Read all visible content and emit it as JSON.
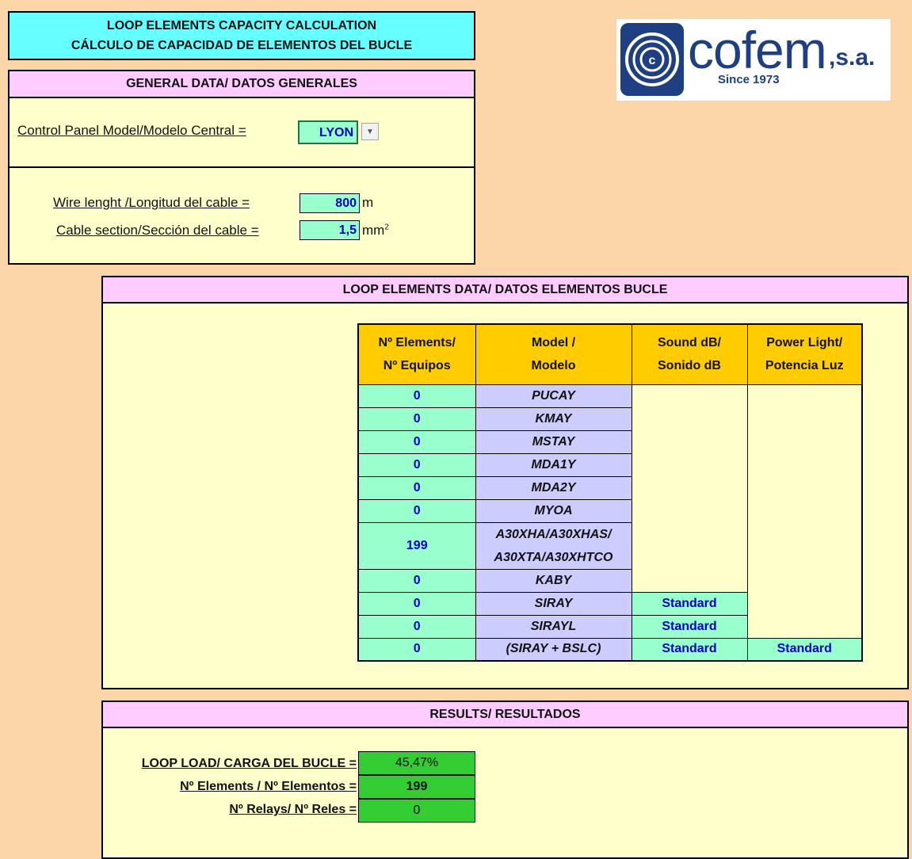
{
  "header": {
    "title_en": "LOOP ELEMENTS CAPACITY CALCULATION",
    "title_es": "CÁLCULO DE CAPACIDAD DE ELEMENTOS DEL BUCLE"
  },
  "logo": {
    "brand": "cofem",
    "suffix": ",s.a.",
    "since": "Since 1973"
  },
  "general": {
    "header": "GENERAL DATA/ DATOS GENERALES",
    "panel_label": "Control Panel Model/Modelo Central =",
    "panel_value": "LYON",
    "wire_label": "Wire lenght /Longitud del cable =",
    "wire_value": "800",
    "wire_unit": "m",
    "section_label": "Cable section/Sección del cable =",
    "section_value": "1,5",
    "section_unit": "mm",
    "section_unit_sup": "2"
  },
  "loop": {
    "header": "LOOP ELEMENTS DATA/ DATOS ELEMENTOS BUCLE",
    "columns": [
      [
        "Nº Elements/",
        "Nº Equipos"
      ],
      [
        "Model /",
        "Modelo"
      ],
      [
        "Sound dB/",
        "Sonido dB"
      ],
      [
        "Power Light/",
        "Potencia Luz"
      ]
    ],
    "rows": [
      {
        "count": "0",
        "model": "PUCAY"
      },
      {
        "count": "0",
        "model": "KMAY"
      },
      {
        "count": "0",
        "model": "MSTAY"
      },
      {
        "count": "0",
        "model": "MDA1Y"
      },
      {
        "count": "0",
        "model": "MDA2Y"
      },
      {
        "count": "0",
        "model": "MYOA"
      },
      {
        "count": "199",
        "model": "A30XHA/A30XHAS/",
        "model2": "A30XTA/A30XHTCO"
      },
      {
        "count": "0",
        "model": "KABY"
      },
      {
        "count": "0",
        "model": "SIRAY",
        "sound": "Standard"
      },
      {
        "count": "0",
        "model": "SIRAYL",
        "sound": "Standard"
      },
      {
        "count": "0",
        "model": "(SIRAY + BSLC)",
        "sound": "Standard",
        "light": "Standard"
      }
    ]
  },
  "results": {
    "header": "RESULTS/ RESULTADOS",
    "load_label": "LOOP LOAD/ CARGA DEL BUCLE =",
    "load_value": "45,47%",
    "elements_label": "Nº Elements / Nº Elementos =",
    "elements_value": "199",
    "relays_label": "Nº Relays/ Nº Reles =",
    "relays_value": "0"
  },
  "colors": {
    "background": "#fcd5a8",
    "title_bg": "#66ffff",
    "panel_bg": "#ffffcc",
    "header_pink": "#ffccff",
    "column_header": "#ffcc00",
    "input_green": "#99ffcc",
    "model_lavender": "#ccccff",
    "result_green": "#33cc33"
  }
}
